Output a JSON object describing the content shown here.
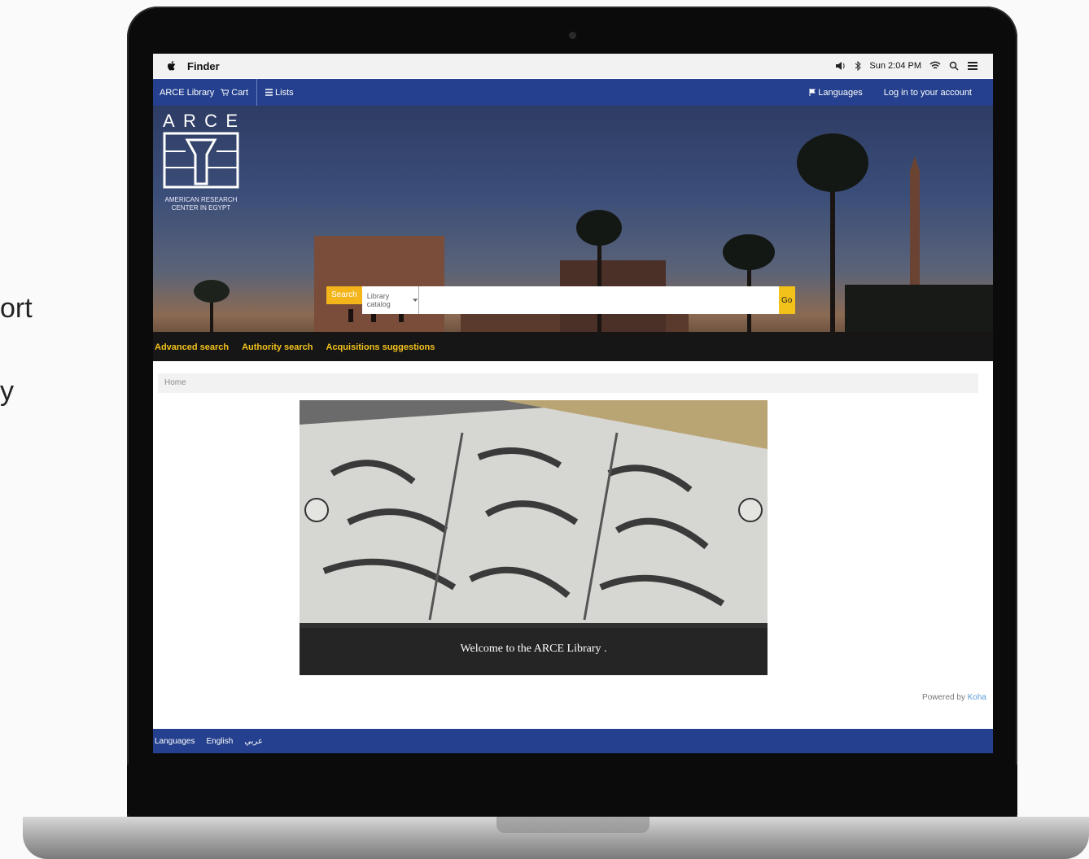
{
  "side_text": {
    "line1": "ort",
    "line2": "y"
  },
  "menubar": {
    "app_name": "Finder",
    "clock": "Sun 2:04 PM"
  },
  "nav": {
    "library_label": "ARCE Library",
    "cart_label": "Cart",
    "lists_label": "Lists",
    "language_label": "Languages",
    "login_label": "Log in to your account"
  },
  "logo": {
    "letters": [
      "A",
      "R",
      "C",
      "E"
    ],
    "subtitle": "AMERICAN RESEARCH CENTER IN EGYPT"
  },
  "search": {
    "tag": "Search",
    "select_value": "Library catalog",
    "go_label": "Go"
  },
  "sublinks": [
    "Advanced search",
    "Authority search",
    "Acquisitions suggestions"
  ],
  "breadcrumb": "Home",
  "carousel": {
    "caption": "Welcome to the ARCE Library ."
  },
  "footer": {
    "powered_prefix": "Powered by",
    "powered_link": "Koha"
  },
  "bottom_bar": [
    "Languages",
    "English",
    "عربي"
  ]
}
